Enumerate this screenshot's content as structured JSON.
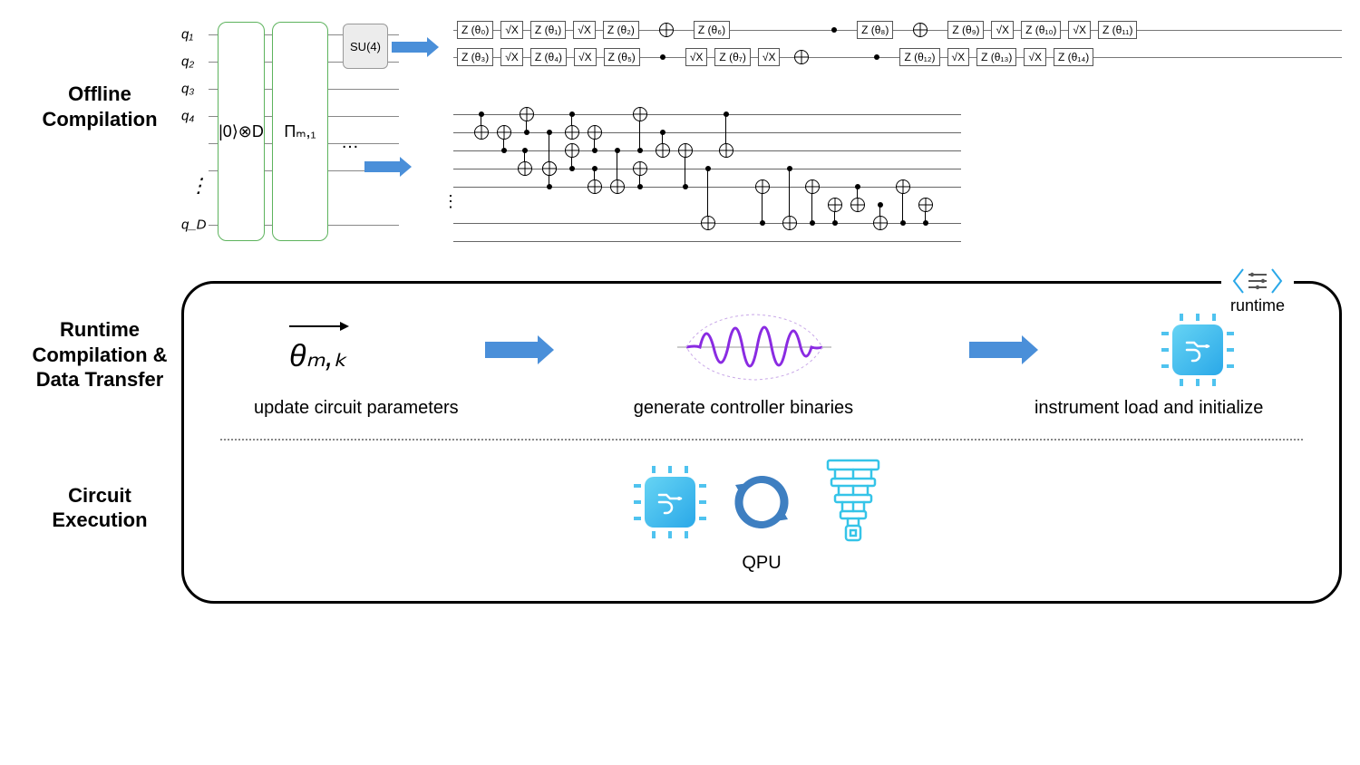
{
  "labels": {
    "offline": "Offline Compilation",
    "runtime": "Runtime Compilation & Data Transfer",
    "exec": "Circuit Execution"
  },
  "qubits": [
    "q₁",
    "q₂",
    "q₃",
    "q₄",
    "",
    "q_D"
  ],
  "blocks": {
    "state0": "|0⟩⊗D",
    "pi": "Πₘ,₁",
    "su4": "SU(4)",
    "ellipsis": "…"
  },
  "gates_q1": [
    "Z (θ₀)",
    "√X",
    "Z (θ₁)",
    "√X",
    "Z (θ₂)",
    "⊕",
    "Z (θ₆)",
    "•",
    "Z (θ₈)",
    "⊕",
    "Z (θ₉)",
    "√X",
    "Z (θ₁₀)",
    "√X",
    "Z (θ₁₁)"
  ],
  "gates_q2": [
    "Z (θ₃)",
    "√X",
    "Z (θ₄)",
    "√X",
    "Z (θ₅)",
    "•",
    "√X",
    "Z (θ₇)",
    "√X",
    "•",
    "Z (θ₁₂)",
    "√X",
    "Z (θ₁₃)",
    "√X",
    "Z (θ₁₄)"
  ],
  "runtime": {
    "tag": "runtime",
    "theta": "θₘ,ₖ",
    "step1": "update circuit parameters",
    "step2": "generate controller binaries",
    "step3": "instrument load and initialize",
    "qpu": "QPU"
  }
}
